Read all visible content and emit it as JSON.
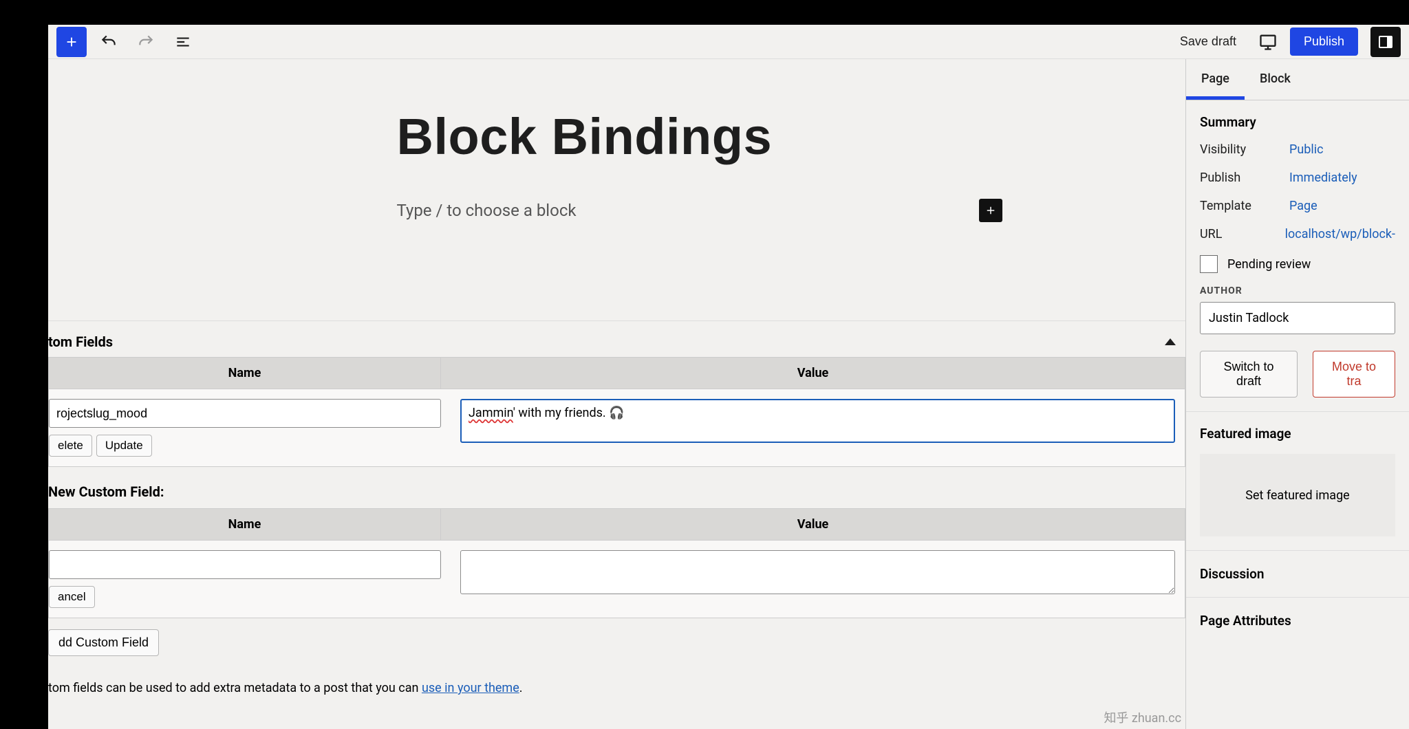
{
  "toolbar": {
    "save_draft": "Save draft",
    "publish": "Publish"
  },
  "editor": {
    "title": "Block Bindings",
    "type_placeholder": "Type / to choose a block"
  },
  "custom_fields": {
    "panel_title": "tom Fields",
    "columns": {
      "name": "Name",
      "value": "Value"
    },
    "row": {
      "name": "rojectslug_mood",
      "value_underlined": "Jammin",
      "value_rest": "' with my friends. 🎧"
    },
    "buttons": {
      "delete": "elete",
      "update": "Update",
      "cancel": "ancel",
      "add": "dd Custom Field"
    },
    "add_heading": "New Custom Field:",
    "footer_pre": "tom fields can be used to add extra metadata to a post that you can ",
    "footer_link": "use in your theme",
    "footer_post": "."
  },
  "sidebar": {
    "tabs": {
      "page": "Page",
      "block": "Block"
    },
    "summary": {
      "title": "Summary",
      "visibility_k": "Visibility",
      "visibility_v": "Public",
      "publish_k": "Publish",
      "publish_v": "Immediately",
      "template_k": "Template",
      "template_v": "Page",
      "url_k": "URL",
      "url_v": "localhost/wp/block-",
      "pending": "Pending review",
      "author_label": "AUTHOR",
      "author_value": "Justin Tadlock",
      "switch_draft": "Switch to draft",
      "move_trash": "Move to tra"
    },
    "featured": {
      "title": "Featured image",
      "button": "Set featured image"
    },
    "discussion": "Discussion",
    "page_attributes": "Page Attributes"
  },
  "watermark": "知乎 zhuan.cc"
}
